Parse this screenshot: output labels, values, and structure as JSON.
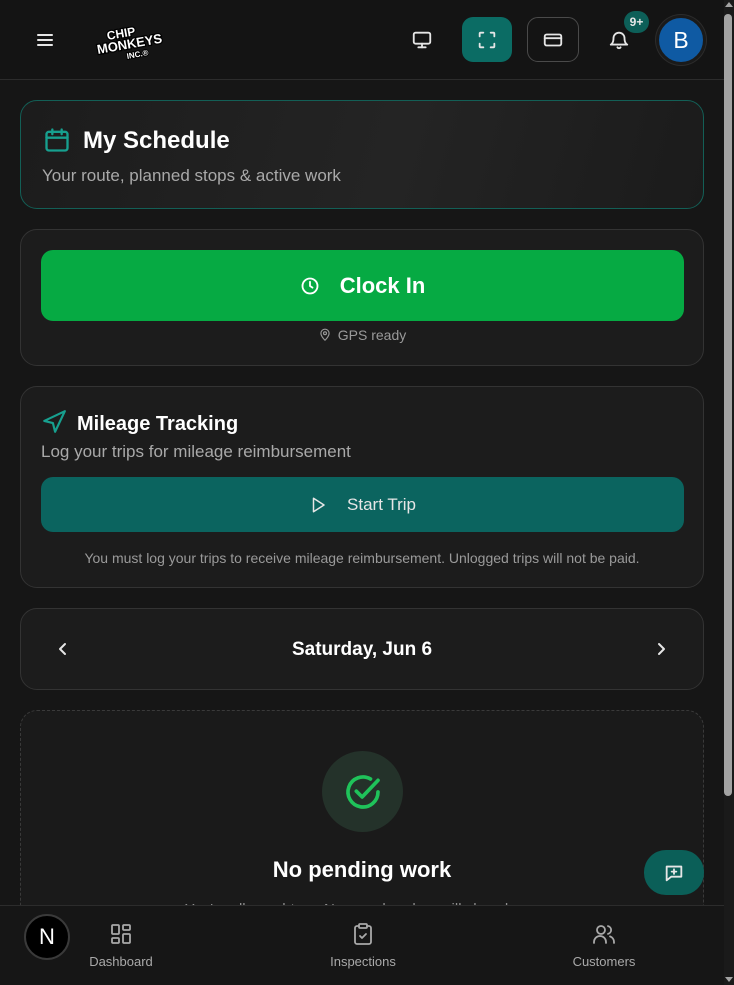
{
  "header": {
    "logo_text": "CHIP MONKEYS INC.",
    "notification_badge": "9+",
    "avatar_initial": "B"
  },
  "schedule": {
    "title": "My Schedule",
    "subtitle": "Your route, planned stops & active work"
  },
  "clock": {
    "button_label": "Clock In",
    "gps_status": "GPS ready"
  },
  "mileage": {
    "title": "Mileage Tracking",
    "subtitle": "Log your trips for mileage reimbursement",
    "button_label": "Start Trip",
    "note": "You must log your trips to receive mileage reimbursement. Unlogged trips will not be paid."
  },
  "date_nav": {
    "label": "Saturday, Jun 6"
  },
  "pending": {
    "title": "No pending work",
    "subtitle": "You're all caught up. New work orders will show here."
  },
  "bottom_nav": {
    "items": [
      {
        "label": "Dashboard"
      },
      {
        "label": "Inspections"
      },
      {
        "label": "Customers"
      }
    ]
  },
  "dev_badge": "N",
  "colors": {
    "accent_teal": "#0b6c64",
    "clock_in_green": "#06aa43",
    "avatar_blue": "#0f5aa3",
    "background": "#161616"
  },
  "icons": [
    "menu-icon",
    "monitor-icon",
    "fullscreen-icon",
    "credit-card-icon",
    "bell-icon",
    "calendar-icon",
    "clock-icon",
    "map-pin-icon",
    "navigation-icon",
    "play-icon",
    "chevron-left-icon",
    "chevron-right-icon",
    "check-circle-icon",
    "message-plus-icon",
    "dashboard-grid-icon",
    "clipboard-check-icon",
    "users-icon"
  ]
}
